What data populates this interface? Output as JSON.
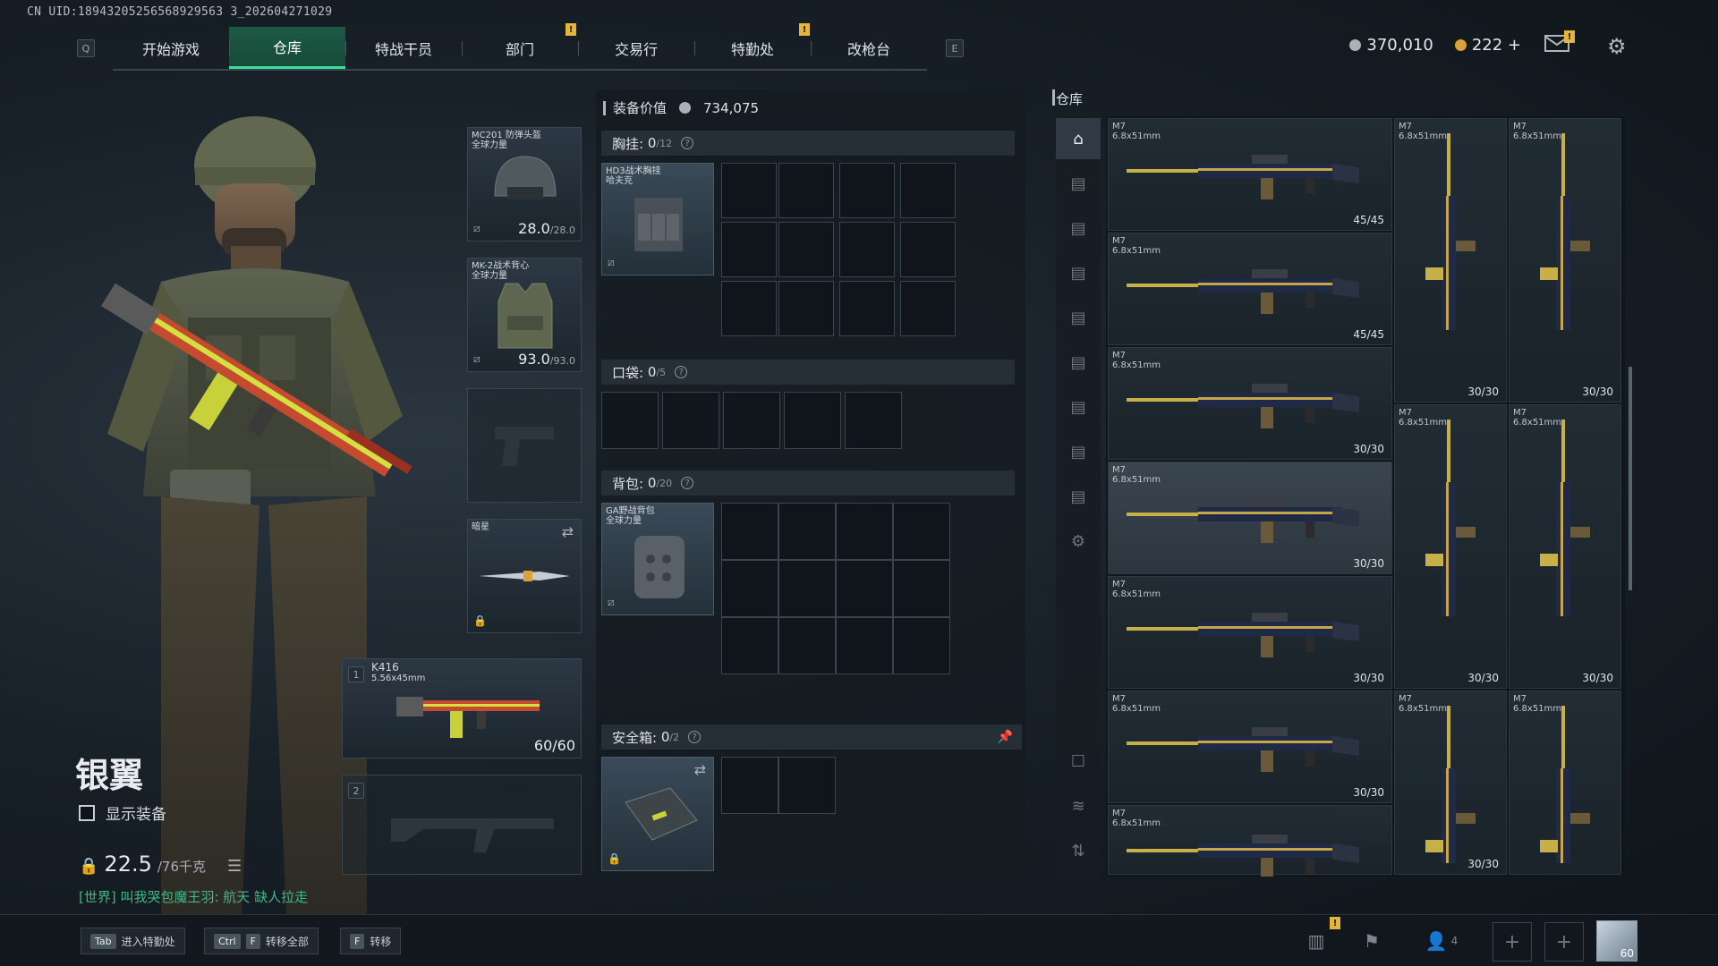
{
  "header": {
    "uid": "CN UID:18943205256568929563 3_202604271029",
    "left_key": "Q",
    "right_key": "E",
    "tabs": [
      "开始游戏",
      "仓库",
      "特战干员",
      "部门",
      "交易行",
      "特勤处",
      "改枪台"
    ],
    "active_tab": "仓库"
  },
  "currency": {
    "silver": "370,010",
    "gold": "222",
    "gold_add": "+"
  },
  "character": {
    "rank_name": "银翼",
    "show_equipment_label": "显示装备",
    "weight_value": "22.5",
    "weight_max": "/76千克",
    "chat_message": "[世界] 叫我哭包魔王羽: 航天  缺人拉走"
  },
  "slots": {
    "helmet": {
      "name": "MC201 防弹头盔",
      "sub": "全球力量",
      "dur": "28.0",
      "max": "/28.0"
    },
    "armor": {
      "name": "MK-2战术背心",
      "sub": "全球力量",
      "dur": "93.0",
      "max": "/93.0"
    },
    "melee": {
      "name": "暗星"
    },
    "weapon1": {
      "index": "1",
      "name": "K416",
      "caliber": "5.56x45mm",
      "ammo": "60/60"
    },
    "weapon2": {
      "index": "2"
    }
  },
  "equipment": {
    "value_label": "装备价值",
    "value": "734,075",
    "chest_rig": {
      "label": "胸挂:",
      "count": "0",
      "cap": "/12",
      "item": "HD3战术胸挂",
      "item_sub": "哈夫克"
    },
    "pockets": {
      "label": "口袋:",
      "count": "0",
      "cap": "/5"
    },
    "backpack": {
      "label": "背包:",
      "count": "0",
      "cap": "/20",
      "item": "GA野战背包",
      "item_sub": "全球力量"
    },
    "safebox": {
      "label": "安全箱:",
      "count": "0",
      "cap": "/2"
    }
  },
  "warehouse": {
    "title": "仓库",
    "items": [
      {
        "name": "M7",
        "caliber": "6.8x51mm",
        "ammo": "45/45"
      },
      {
        "name": "M7",
        "caliber": "6.8x51mm",
        "ammo": "30/30"
      },
      {
        "name": "M7",
        "caliber": "6.8x51mm",
        "ammo": "30/30"
      },
      {
        "name": "M7",
        "caliber": "6.8x51mm",
        "ammo": "45/45"
      },
      {
        "name": "M7",
        "caliber": "6.8x51mm",
        "ammo": "30/30"
      },
      {
        "name": "M7",
        "caliber": "6.8x51mm",
        "ammo": "30/30"
      },
      {
        "name": "M7",
        "caliber": "6.8x51mm",
        "ammo": "30/30"
      },
      {
        "name": "M7",
        "caliber": "6.8x51mm",
        "ammo": "30/30"
      },
      {
        "name": "M7",
        "caliber": "6.8x51mm",
        "ammo": "30/30"
      },
      {
        "name": "M7",
        "caliber": "6.8x51mm",
        "ammo": "30/30"
      },
      {
        "name": "M7",
        "caliber": "6.8x51mm",
        "ammo": "30/30"
      },
      {
        "name": "M7",
        "caliber": "6.8x51mm",
        "ammo": ""
      },
      {
        "name": "M7",
        "caliber": "6.8x51mm",
        "ammo": ""
      },
      {
        "name": "M7",
        "caliber": "6.8x51mm",
        "ammo": ""
      }
    ]
  },
  "bottom_bar": {
    "hotkeys": [
      {
        "keys": [
          "Tab"
        ],
        "label": "进入特勤处"
      },
      {
        "keys": [
          "Ctrl",
          "F"
        ],
        "label": "转移全部"
      },
      {
        "keys": [
          "F"
        ],
        "label": "转移"
      }
    ],
    "squad_count": "4",
    "level": "60"
  },
  "colors": {
    "accent": "#3ee0a0",
    "notice": "#e5b53a",
    "active_tab_bg": "#1d5a46"
  }
}
